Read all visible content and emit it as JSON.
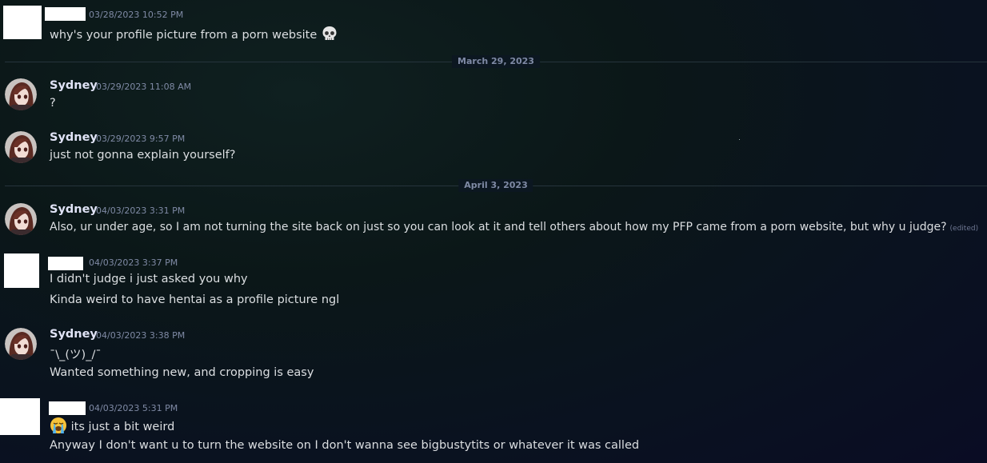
{
  "messages": [
    {
      "author": "",
      "timestamp": "03/28/2023 10:52 PM",
      "lines": [
        "why's your profile picture from a porn website"
      ],
      "emoji": "skull-emoji"
    },
    {
      "author": "Sydney",
      "timestamp": "03/29/2023 11:08 AM",
      "lines": [
        "?"
      ]
    },
    {
      "author": "Sydney",
      "timestamp": "03/29/2023 9:57 PM",
      "lines": [
        "just not gonna explain yourself?"
      ]
    },
    {
      "author": "Sydney",
      "timestamp": "04/03/2023 3:31 PM",
      "lines": [
        "Also, ur under age, so I am not turning the site back on just so you can look at it and tell others about how my PFP came from a porn website, but why u judge?"
      ],
      "edited": "(edited)"
    },
    {
      "author": "",
      "timestamp": "04/03/2023 3:37 PM",
      "lines": [
        "I didn't judge i just asked you why",
        "Kinda weird to have hentai as a profile picture ngl"
      ]
    },
    {
      "author": "Sydney",
      "timestamp": "04/03/2023 3:38 PM",
      "lines": [
        "¯\\_(ツ)_/¯",
        "Wanted something new, and cropping is easy"
      ]
    },
    {
      "author": "",
      "timestamp": "04/03/2023 5:31 PM",
      "lines": [
        "its just a bit weird",
        "Anyway I don't want u to turn the website on I don't wanna see bigbustytits or whatever it was called"
      ],
      "emoji": "loudly-crying-emoji"
    }
  ],
  "dividers": [
    "March 29, 2023",
    "April 3, 2023"
  ],
  "colors": {
    "accent_name": "#e0e3f6",
    "timestamp": "#7f8aa5",
    "text": "#dbdee1"
  }
}
